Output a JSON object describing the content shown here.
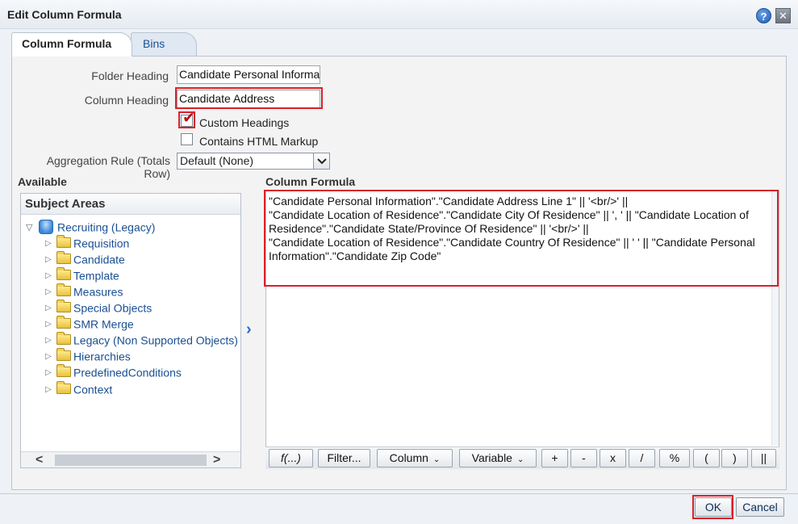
{
  "dialog": {
    "title": "Edit Column Formula",
    "help_icon": "?",
    "close_icon": "✕"
  },
  "tabs": [
    {
      "label": "Column Formula",
      "active": true
    },
    {
      "label": "Bins",
      "active": false
    }
  ],
  "form": {
    "folder_heading_label": "Folder Heading",
    "folder_heading_value": "Candidate Personal Information",
    "column_heading_label": "Column Heading",
    "column_heading_value": "Candidate Address",
    "custom_headings_label": "Custom Headings",
    "custom_headings_checked": true,
    "html_markup_label": "Contains HTML Markup",
    "html_markup_checked": false,
    "aggregation_label": "Aggregation Rule (Totals Row)",
    "aggregation_value": "Default (None)"
  },
  "available": {
    "heading": "Available",
    "panel_title": "Subject Areas",
    "root": {
      "label": "Recruiting (Legacy)",
      "icon": "subject-area-icon"
    },
    "items": [
      {
        "label": "Requisition",
        "icon": "folder-icon"
      },
      {
        "label": "Candidate",
        "icon": "folder-icon"
      },
      {
        "label": "Template",
        "icon": "folder-icon"
      },
      {
        "label": "Measures",
        "icon": "folder-icon"
      },
      {
        "label": "Special Objects",
        "icon": "folder-icon"
      },
      {
        "label": "SMR Merge",
        "icon": "folder-icon"
      },
      {
        "label": "Legacy (Non Supported Objects)",
        "icon": "folder-icon"
      },
      {
        "label": "Hierarchies",
        "icon": "folder-icon"
      },
      {
        "label": "PredefinedConditions",
        "icon": "folder-icon"
      },
      {
        "label": "Context",
        "icon": "folder-icon"
      }
    ]
  },
  "formula": {
    "heading": "Column Formula",
    "text": "\"Candidate Personal Information\".\"Candidate Address Line 1\" || '<br/>' ||\n\"Candidate Location of Residence\".\"Candidate City Of Residence\" || ', ' || \"Candidate Location of Residence\".\"Candidate State/Province Of Residence\" || '<br/>' ||\n\"Candidate Location of Residence\".\"Candidate Country Of Residence\" || ' ' || \"Candidate Personal Information\".\"Candidate Zip Code\"",
    "buttons": [
      {
        "label": "f(...)"
      },
      {
        "label": "Filter..."
      },
      {
        "label": "Column",
        "dropdown": true
      },
      {
        "label": "Variable",
        "dropdown": true
      },
      {
        "label": "+"
      },
      {
        "label": "-"
      },
      {
        "label": "x"
      },
      {
        "label": "/"
      },
      {
        "label": "%"
      },
      {
        "label": "("
      },
      {
        "label": ")"
      },
      {
        "label": "||"
      }
    ]
  },
  "footer": {
    "ok_label": "OK",
    "cancel_label": "Cancel"
  },
  "colors": {
    "highlight": "#d9202a",
    "link": "#1a4f93"
  }
}
